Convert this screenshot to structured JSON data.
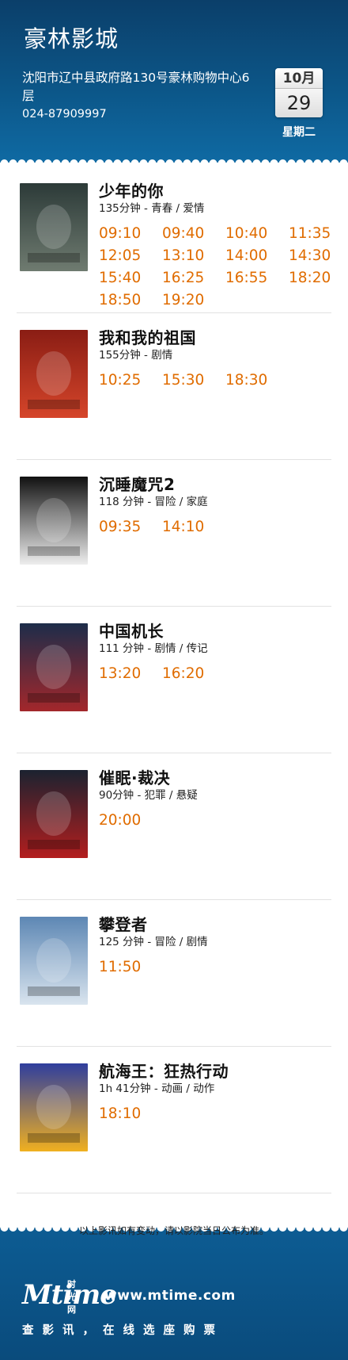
{
  "cinema": {
    "name": "豪林影城",
    "address": "沈阳市辽中县政府路130号豪林购物中心6层",
    "phone": "024-87909997"
  },
  "date": {
    "month": "10月",
    "day": "29",
    "weekday": "星期二"
  },
  "movies": [
    {
      "title": "少年的你",
      "meta": "135分钟 - 青春 / 爱情",
      "showtimes": [
        "09:10",
        "09:40",
        "10:40",
        "11:35",
        "12:05",
        "13:10",
        "14:00",
        "14:30",
        "15:40",
        "16:25",
        "16:55",
        "18:20",
        "18:50",
        "19:20"
      ],
      "poster_colors": [
        "#2c3a38",
        "#6f7b70"
      ]
    },
    {
      "title": "我和我的祖国",
      "meta": "155分钟 - 剧情",
      "showtimes": [
        "10:25",
        "15:30",
        "18:30"
      ],
      "poster_colors": [
        "#8a1d14",
        "#d5452a"
      ]
    },
    {
      "title": "沉睡魔咒2",
      "meta": "118 分钟 - 冒险 / 家庭",
      "showtimes": [
        "09:35",
        "14:10"
      ],
      "poster_colors": [
        "#111111",
        "#eeeeee"
      ]
    },
    {
      "title": "中国机长",
      "meta": "111 分钟 - 剧情 / 传记",
      "showtimes": [
        "13:20",
        "16:20"
      ],
      "poster_colors": [
        "#1d2d4a",
        "#a3272b"
      ]
    },
    {
      "title": "催眠·裁决",
      "meta": "90分钟 - 犯罪 / 悬疑",
      "showtimes": [
        "20:00"
      ],
      "poster_colors": [
        "#1b2230",
        "#b31e1e"
      ]
    },
    {
      "title": "攀登者",
      "meta": "125 分钟 - 冒险 / 剧情",
      "showtimes": [
        "11:50"
      ],
      "poster_colors": [
        "#5d87b4",
        "#d9e4ee"
      ]
    },
    {
      "title": "航海王：狂热行动",
      "meta": "1h 41分钟 - 动画 / 动作",
      "showtimes": [
        "18:10"
      ],
      "poster_colors": [
        "#2f3e9e",
        "#f0b020"
      ]
    }
  ],
  "note": "以上影讯如有变动，请以影院当日公布为准。",
  "footer": {
    "logo_text": "Mtime",
    "logo_cn": "时光网",
    "url": "www.mtime.com",
    "slogan": "查影讯，在线选座购票"
  },
  "colors": {
    "header_blue": "#0c5688",
    "showtime_orange": "#e06c00"
  }
}
